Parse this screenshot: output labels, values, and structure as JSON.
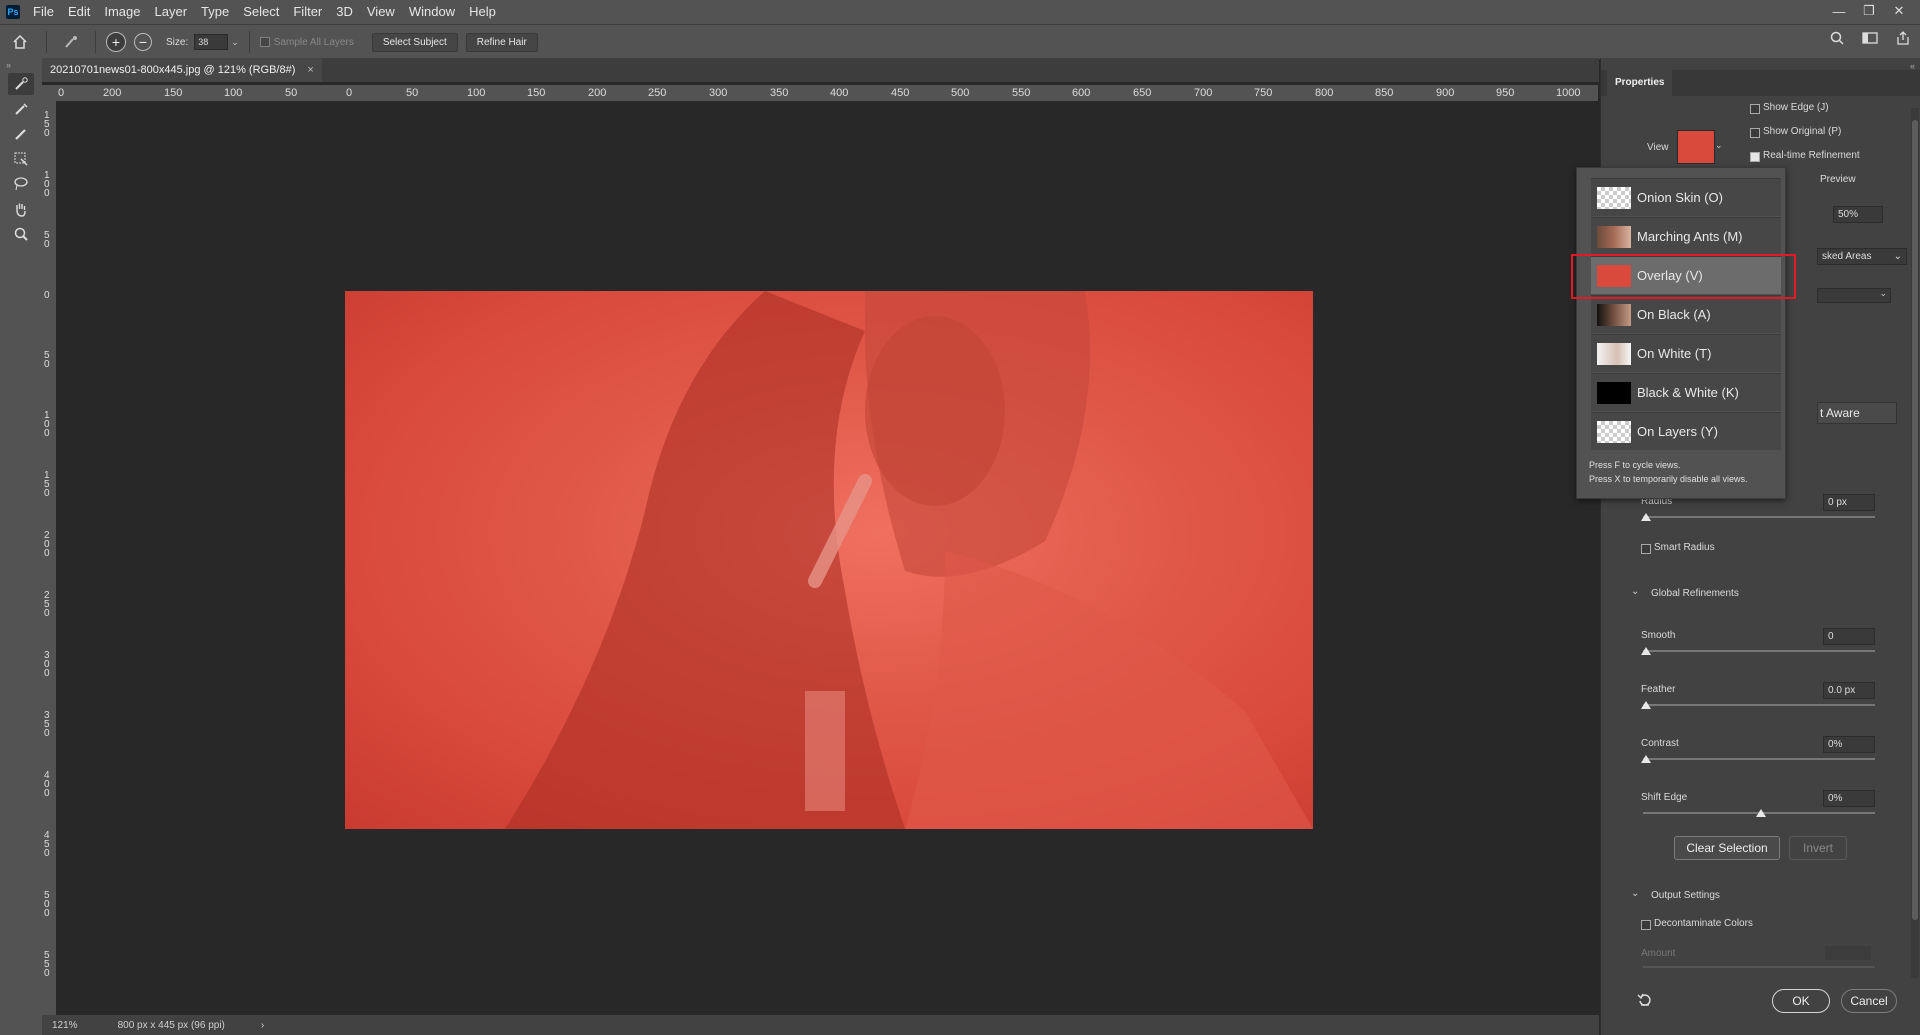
{
  "menubar": {
    "logo": "Ps",
    "items": [
      "File",
      "Edit",
      "Image",
      "Layer",
      "Type",
      "Select",
      "Filter",
      "3D",
      "View",
      "Window",
      "Help"
    ],
    "window_controls": [
      "—",
      "❐",
      "✕"
    ]
  },
  "optionsbar": {
    "size_label": "Size:",
    "size_value": "38",
    "sample_all_layers": "Sample All Layers",
    "select_subject": "Select Subject",
    "refine_hair": "Refine Hair"
  },
  "document": {
    "tab_title": "20210701news01-800x445.jpg @ 121% (RGB/8#)",
    "tab_close": "×",
    "zoom": "121%",
    "info": "800 px x 445 px (96 ppi)",
    "info_arrow": "›"
  },
  "rulers": {
    "horizontal": [
      "0",
      "200",
      "150",
      "100",
      "50",
      "0",
      "50",
      "100",
      "150",
      "200",
      "250",
      "300",
      "350",
      "400",
      "450",
      "500",
      "550",
      "600",
      "650",
      "700",
      "750",
      "800",
      "850",
      "900",
      "950",
      "1000"
    ],
    "vertical": [
      "150",
      "100",
      "50",
      "0",
      "50",
      "100",
      "150",
      "200",
      "250",
      "300",
      "350",
      "400",
      "450",
      "500",
      "550"
    ]
  },
  "properties": {
    "tab": "Properties",
    "view_label": "View",
    "show_edge": "Show Edge (J)",
    "show_original": "Show Original (P)",
    "realtime": "Real-time Refinement",
    "preview_partial": "Preview",
    "opacity_partial": "50%",
    "masked_partial": "sked Areas",
    "aware_partial": "t Aware",
    "radius_label": "Radius",
    "radius_value": "0 px",
    "smart_radius": "Smart Radius",
    "global_refinements": "Global Refinements",
    "smooth_label": "Smooth",
    "smooth_value": "0",
    "feather_label": "Feather",
    "feather_value": "0.0 px",
    "contrast_label": "Contrast",
    "contrast_value": "0%",
    "shift_label": "Shift Edge",
    "shift_value": "0%",
    "clear_selection": "Clear Selection",
    "invert": "Invert",
    "output_settings": "Output Settings",
    "decontaminate": "Decontaminate Colors",
    "amount_label": "Amount",
    "ok": "OK",
    "cancel": "Cancel"
  },
  "view_menu": {
    "items": [
      {
        "label": "Onion Skin (O)"
      },
      {
        "label": "Marching Ants (M)"
      },
      {
        "label": "Overlay (V)"
      },
      {
        "label": "On Black (A)"
      },
      {
        "label": "On White (T)"
      },
      {
        "label": "Black & White (K)"
      },
      {
        "label": "On Layers (Y)"
      }
    ],
    "selected_index": 2,
    "hint1": "Press F to cycle views.",
    "hint2": "Press X to temporarily disable all views."
  },
  "colors": {
    "overlay_red": "#d94a3c",
    "highlight": "#e01b24"
  }
}
